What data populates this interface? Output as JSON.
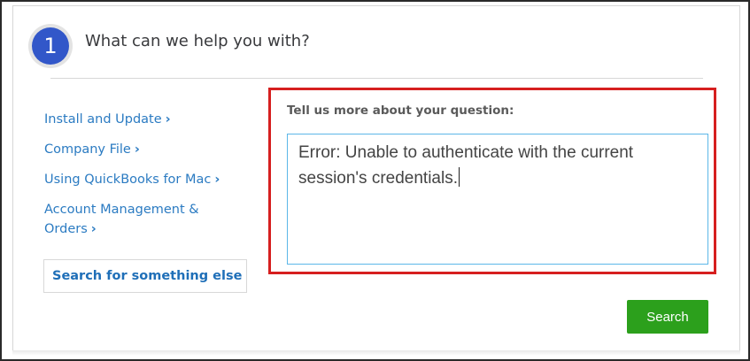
{
  "step": {
    "number": "1",
    "title": "What can we help you with?"
  },
  "nav": {
    "items": [
      {
        "label": "Install and Update"
      },
      {
        "label": "Company File"
      },
      {
        "label": "Using QuickBooks for Mac"
      },
      {
        "label": "Account Management & Orders"
      }
    ],
    "search_else": "Search for something else"
  },
  "question": {
    "label": "Tell us more about your question:",
    "value": "Error: Unable to authenticate with the current session's credentials."
  },
  "actions": {
    "search_label": "Search"
  },
  "colors": {
    "step_circle": "#3257c9",
    "link": "#2b7bc2",
    "highlight_border": "#d61f1f",
    "input_border": "#5cb7e8",
    "search_button": "#2ca01c"
  }
}
